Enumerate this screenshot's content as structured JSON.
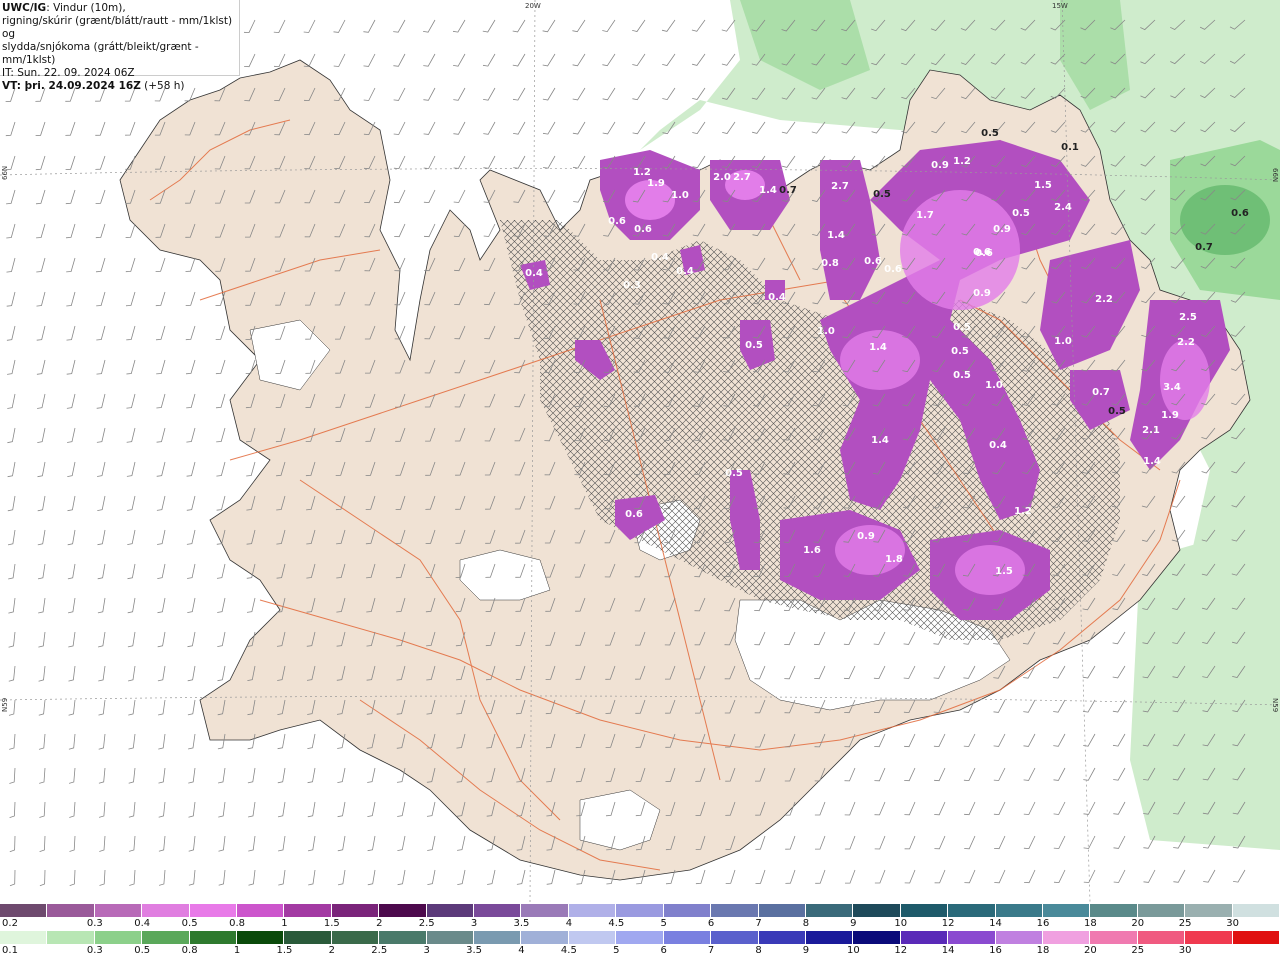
{
  "header": {
    "title_bold": "UWC/IG",
    "title_rest": ": Vindur (10m),",
    "line2": "rigning/skúrir (grænt/blátt/rautt - mm/1klst) og",
    "line3": "slydda/snjókoma (grátt/bleikt/grænt - mm/1klst)",
    "init_time": "IT: Sun. 22. 09. 2024 06Z",
    "valid_label": "VT: þri. 24.09.2024 16Z",
    "valid_offset": "(+58 h)"
  },
  "graticule": {
    "lon_labels": [
      "20W",
      "15W"
    ],
    "lat_labels_left": [
      "66N",
      "N59"
    ],
    "lat_labels_right": [
      "66N",
      "N59"
    ]
  },
  "colors": {
    "land": "#f0e2d4",
    "sea": "#ffffff",
    "roads": "#e2693a",
    "rain_light": "#cfeccc",
    "rain_mid": "#9bd99a",
    "rain_heavy": "#3f9a55",
    "snow_light": "#e27de9",
    "snow_mid": "#b24fc0",
    "snow_dark": "#6e2f70",
    "hatch": "#555555"
  },
  "precip_labels": [
    {
      "text": "1.2"
    },
    {
      "text": "1.9"
    },
    {
      "text": "1.0"
    },
    {
      "text": "0.6"
    },
    {
      "text": "0.6"
    },
    {
      "text": "2.0"
    },
    {
      "text": "2.7"
    },
    {
      "text": "1.4"
    },
    {
      "text": "0.7"
    },
    {
      "text": "2.7"
    },
    {
      "text": "0.5"
    },
    {
      "text": "0.9"
    },
    {
      "text": "1.2"
    },
    {
      "text": "1.7"
    },
    {
      "text": "1.5"
    },
    {
      "text": "2.4"
    },
    {
      "text": "0.6"
    },
    {
      "text": "0.7"
    },
    {
      "text": "0.5"
    },
    {
      "text": "0.6"
    },
    {
      "text": "0.4"
    },
    {
      "text": "0.4"
    },
    {
      "text": "0.3"
    },
    {
      "text": "0.4"
    },
    {
      "text": "1.4"
    },
    {
      "text": "0.6"
    },
    {
      "text": "0.6"
    },
    {
      "text": "0.9"
    },
    {
      "text": "0.6"
    },
    {
      "text": "0.9"
    },
    {
      "text": "2.2"
    },
    {
      "text": "1.0"
    },
    {
      "text": "1.4"
    },
    {
      "text": "0.5"
    },
    {
      "text": "0.5"
    },
    {
      "text": "1.0"
    },
    {
      "text": "0.5"
    },
    {
      "text": "0.7"
    },
    {
      "text": "0.5"
    },
    {
      "text": "2.5"
    },
    {
      "text": "2.2"
    },
    {
      "text": "3.4"
    },
    {
      "text": "1.9"
    },
    {
      "text": "2.1"
    },
    {
      "text": "1.4"
    },
    {
      "text": "1.4"
    },
    {
      "text": "0.4"
    },
    {
      "text": "1.2"
    },
    {
      "text": "0.6"
    },
    {
      "text": "0.5"
    },
    {
      "text": "1.6"
    },
    {
      "text": "0.9"
    },
    {
      "text": "1.8"
    },
    {
      "text": "1.5"
    },
    {
      "text": "0.5"
    },
    {
      "text": "0.8"
    },
    {
      "text": "0.5"
    },
    {
      "text": "0.4"
    },
    {
      "text": "0.1"
    },
    {
      "text": "1.0"
    }
  ],
  "legend_snow": {
    "colors": [
      "#6e4a6e",
      "#9a5a9a",
      "#b86ab8",
      "#e07ee0",
      "#e87ae8",
      "#cc55cc",
      "#a33aa3",
      "#7a247a",
      "#4d0a4d",
      "#5c3a7a",
      "#7a4a9a",
      "#9a7ab8",
      "#b0b0e8",
      "#9a9ae0",
      "#8080cc",
      "#6a78b0",
      "#5a70a0",
      "#3a6a7a",
      "#1e4a5a",
      "#1e5a6a",
      "#2a6a7a",
      "#3a7a8a",
      "#4a8a9a",
      "#5a8a8a",
      "#7a9a9a",
      "#9ab0b0",
      "#d0e0e0"
    ],
    "labels": [
      "0.2",
      "0.3",
      "0.4",
      "0.5",
      "0.8",
      "1",
      "1.5",
      "2",
      "2.5",
      "3",
      "3.5",
      "4",
      "4.5",
      "5",
      "6",
      "7",
      "8",
      "9",
      "10",
      "12",
      "14",
      "16",
      "18",
      "20",
      "25",
      "30"
    ]
  },
  "legend_rain": {
    "colors": [
      "#dff5dc",
      "#b8e6b4",
      "#8cd08a",
      "#5aa85a",
      "#2e7a2e",
      "#0a4a0a",
      "#2a5a3a",
      "#3a6a4a",
      "#4a7a6a",
      "#6a8a8a",
      "#7a9ab0",
      "#a0b0d8",
      "#c0c8f0",
      "#a0a8f0",
      "#7a80e0",
      "#5a60cc",
      "#3a3ab8",
      "#1a1a9a",
      "#0a0a7a",
      "#5a2ab8",
      "#8a4ad0",
      "#c080e0",
      "#f0a0e0",
      "#f07ab0",
      "#f05a80",
      "#f03a50",
      "#e01010"
    ],
    "labels": [
      "0.1",
      "0.3",
      "0.5",
      "0.8",
      "1",
      "1.5",
      "2",
      "2.5",
      "3",
      "3.5",
      "4",
      "4.5",
      "5",
      "6",
      "7",
      "8",
      "9",
      "10",
      "12",
      "14",
      "16",
      "18",
      "20",
      "25",
      "30"
    ]
  }
}
